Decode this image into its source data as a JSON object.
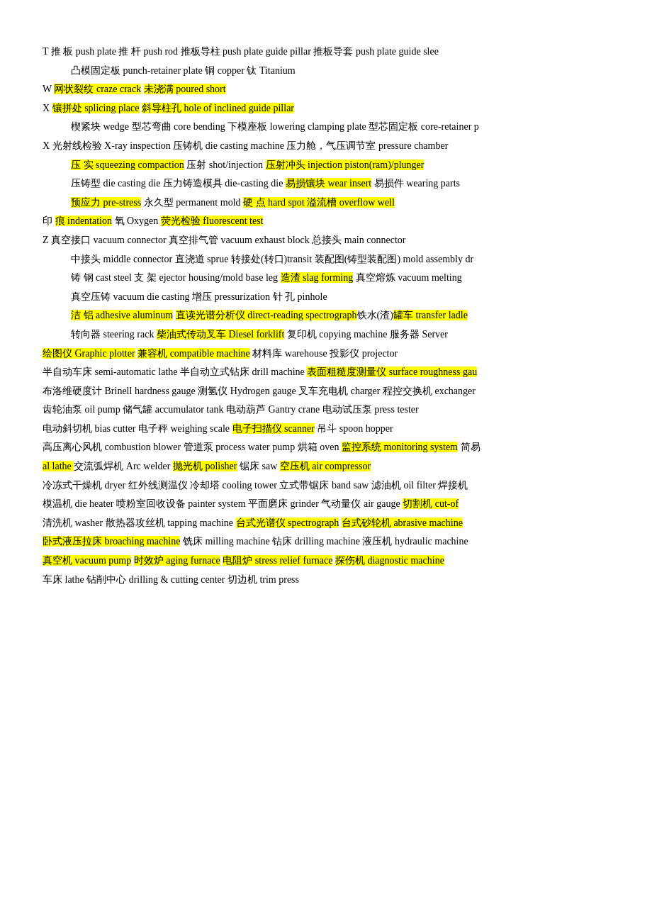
{
  "lines": [
    {
      "id": "line-T",
      "indent": false,
      "prefix": "T",
      "segments": [
        {
          "text": " 推 板 push plate 推 杆 push rod 推板导柱 push plate guide pillar 推板导套 push plate guide slee",
          "highlight": false
        }
      ]
    },
    {
      "id": "line-indent1",
      "indent": true,
      "prefix": "",
      "segments": [
        {
          "text": "凸模固定板 punch-retainer plate 铜 copper   钛 Titanium",
          "highlight": false
        }
      ]
    },
    {
      "id": "line-W",
      "indent": false,
      "prefix": "W",
      "segments": [
        {
          "text": " ",
          "highlight": false
        },
        {
          "text": "网状裂纹 craze crack",
          "highlight": true
        },
        {
          "text": " ",
          "highlight": false
        },
        {
          "text": "未浇满 poured short",
          "highlight": true
        }
      ]
    },
    {
      "id": "line-X1",
      "indent": false,
      "prefix": "X",
      "segments": [
        {
          "text": " ",
          "highlight": false
        },
        {
          "text": "镶拼处 splicing place",
          "highlight": true
        },
        {
          "text": "   ",
          "highlight": false
        },
        {
          "text": "斜导柱孔 hole of inclined guide pillar",
          "highlight": true
        }
      ]
    },
    {
      "id": "line-indent2",
      "indent": true,
      "prefix": "",
      "segments": [
        {
          "text": "楔紧块 wedge 型芯弯曲 core bending 下模座板  lowering clamping plate 型芯固定板 core-retainer p",
          "highlight": false
        }
      ]
    },
    {
      "id": "line-X2",
      "indent": false,
      "prefix": "",
      "segments": [
        {
          "text": "X 光射线检验 X-ray inspection 压铸机 die casting machine 压力舱，气压调节室 pressure chamber",
          "highlight": false
        }
      ]
    },
    {
      "id": "line-indent3",
      "indent": true,
      "prefix": "",
      "segments": [
        {
          "text": "压 实 ",
          "highlight": true
        },
        {
          "text": "squeezing compaction",
          "highlight": true
        },
        {
          "text": " 压射 shot/injection ",
          "highlight": false
        },
        {
          "text": "压射冲头 injection piston(ram)/plunger",
          "highlight": true
        }
      ]
    },
    {
      "id": "line-indent4",
      "indent": true,
      "prefix": "",
      "segments": [
        {
          "text": "压铸型 die casting die 压力铸造模具 die-casting die ",
          "highlight": false
        },
        {
          "text": "易损镶块 wear insert",
          "highlight": true
        },
        {
          "text": " 易损件 wearing parts",
          "highlight": false
        }
      ]
    },
    {
      "id": "line-indent5",
      "indent": true,
      "prefix": "",
      "segments": [
        {
          "text": "预应力 ",
          "highlight": true
        },
        {
          "text": "pre-stress",
          "highlight": true
        },
        {
          "text": " 永久型 permanent mold ",
          "highlight": false
        },
        {
          "text": "硬 点 hard spot 溢流槽 overflow well",
          "highlight": true
        }
      ]
    },
    {
      "id": "line-yin",
      "indent": false,
      "prefix": "印",
      "segments": [
        {
          "text": " ",
          "highlight": false
        },
        {
          "text": "痕 indentation",
          "highlight": true
        },
        {
          "text": " 氧 Oxygen ",
          "highlight": false
        },
        {
          "text": "荧光检验 fluorescent test",
          "highlight": true
        }
      ]
    },
    {
      "id": "line-Z",
      "indent": false,
      "prefix": "Z",
      "segments": [
        {
          "text": " 真空接口 vacuum connector 真空排气管 vacuum exhaust block 总接头 main connector",
          "highlight": false
        }
      ]
    },
    {
      "id": "line-indent6",
      "indent": true,
      "prefix": "",
      "segments": [
        {
          "text": "中接头 middle connector 直浇道 sprue  转接处(转口)transit 装配图(铸型装配图) mold assembly dr",
          "highlight": false
        }
      ]
    },
    {
      "id": "line-indent7",
      "indent": true,
      "prefix": "",
      "segments": [
        {
          "text": "铸 钢 cast steel 支 架 ejector housing/mold base leg ",
          "highlight": false
        },
        {
          "text": "造渣 slag forming",
          "highlight": true
        },
        {
          "text": " 真空熔炼 vacuum melting",
          "highlight": false
        }
      ]
    },
    {
      "id": "line-indent8",
      "indent": true,
      "prefix": "",
      "segments": [
        {
          "text": "真空压铸 vacuum die casting 增压 pressurization 针 孔 pinhole",
          "highlight": false
        }
      ]
    },
    {
      "id": "line-indent9",
      "indent": true,
      "prefix": "",
      "segments": [
        {
          "text": "洁 铝 ",
          "highlight": true
        },
        {
          "text": "adhesive aluminum",
          "highlight": true
        },
        {
          "text": " ",
          "highlight": false
        },
        {
          "text": "直读光谱分析仪 direct-reading spectrograph",
          "highlight": true
        },
        {
          "text": "铁水(渣)",
          "highlight": false
        },
        {
          "text": "罐车 transfer ladle",
          "highlight": true
        }
      ]
    },
    {
      "id": "line-indent10",
      "indent": true,
      "prefix": "",
      "segments": [
        {
          "text": "转向器 steering rack ",
          "highlight": false
        },
        {
          "text": "柴油式传动叉车 Diesel forklift",
          "highlight": true
        },
        {
          "text": " 复印机 copying machine ",
          "highlight": false
        },
        {
          "text": "服务器 Server",
          "highlight": false
        }
      ]
    },
    {
      "id": "line-hui",
      "indent": false,
      "prefix": "",
      "segments": [
        {
          "text": "绘图仪 ",
          "highlight": true
        },
        {
          "text": "Graphic plotter",
          "highlight": true
        },
        {
          "text": " ",
          "highlight": false
        },
        {
          "text": "兼容机 compatible machine",
          "highlight": true
        },
        {
          "text": " 材料库 warehouse 投影仪 projector",
          "highlight": false
        }
      ]
    },
    {
      "id": "line-ban",
      "indent": false,
      "prefix": "",
      "segments": [
        {
          "text": "半自动车床 semi-automatic lathe 半自动立式钻床 drill machine ",
          "highlight": false
        },
        {
          "text": "表面粗糙度测量仪 surface roughness gau",
          "highlight": true
        }
      ]
    },
    {
      "id": "line-bu",
      "indent": false,
      "prefix": "",
      "segments": [
        {
          "text": "布洛维硬度计 Brinell hardness gauge 测氢仪 Hydrogen gauge 叉车充电机 charger 程控交换机 exchanger",
          "highlight": false
        }
      ]
    },
    {
      "id": "line-chi",
      "indent": false,
      "prefix": "",
      "segments": [
        {
          "text": "齿轮油泵 oil pump 储气罐 accumulator tank 电动葫芦 Gantry crane 电动试压泵 press tester",
          "highlight": false
        }
      ]
    },
    {
      "id": "line-dian",
      "indent": false,
      "prefix": "",
      "segments": [
        {
          "text": "电动斜切机 bias cutter 电子秤 weighing scale ",
          "highlight": false
        },
        {
          "text": "电子扫描仪 scanner",
          "highlight": true
        },
        {
          "text": " 吊斗 spoon hopper",
          "highlight": false
        }
      ]
    },
    {
      "id": "line-gao",
      "indent": false,
      "prefix": "",
      "segments": [
        {
          "text": "高压离心风机 combustion blower 管道泵 process water pump 烘箱 oven ",
          "highlight": false
        },
        {
          "text": "监控系统 monitoring system",
          "highlight": true
        },
        {
          "text": " 简易",
          "highlight": false
        }
      ]
    },
    {
      "id": "line-al",
      "indent": false,
      "prefix": "",
      "segments": [
        {
          "text": "al lathe ",
          "highlight": true
        },
        {
          "text": "交流弧焊机 Arc welder ",
          "highlight": false
        },
        {
          "text": "抛光机 polisher",
          "highlight": true
        },
        {
          "text": " 锯床 saw ",
          "highlight": false
        },
        {
          "text": "空压机 air compressor",
          "highlight": true
        }
      ]
    },
    {
      "id": "line-leng",
      "indent": false,
      "prefix": "",
      "segments": [
        {
          "text": "冷冻式干燥机 dryer 红外线测温仪 冷却塔 cooling tower 立式带锯床 band saw 滤油机 oil filter 焊接机",
          "highlight": false
        }
      ]
    },
    {
      "id": "line-mo",
      "indent": false,
      "prefix": "",
      "segments": [
        {
          "text": "模温机 die heater 喷粉室回收设备 painter system 平面磨床 grinder 气动量仪 air gauge ",
          "highlight": false
        },
        {
          "text": "切割机 cut-of",
          "highlight": true
        }
      ]
    },
    {
      "id": "line-qing",
      "indent": false,
      "prefix": "",
      "segments": [
        {
          "text": "清洗机 washer 散热器攻丝机 tapping machine ",
          "highlight": false
        },
        {
          "text": "台式光谱仪 spectrograph",
          "highlight": true
        },
        {
          "text": " ",
          "highlight": false
        },
        {
          "text": "台式砂轮机 abrasive machine",
          "highlight": true
        }
      ]
    },
    {
      "id": "line-wo",
      "indent": false,
      "prefix": "",
      "segments": [
        {
          "text": "卧式液压拉床 ",
          "highlight": true
        },
        {
          "text": "broaching machine",
          "highlight": true
        },
        {
          "text": " 铣床 milling machine 钻床 drilling machine 液压机 hydraulic machine",
          "highlight": false
        }
      ]
    },
    {
      "id": "line-zhen",
      "indent": false,
      "prefix": "",
      "segments": [
        {
          "text": "真空机 ",
          "highlight": true
        },
        {
          "text": "vacuum pump",
          "highlight": true
        },
        {
          "text": " ",
          "highlight": false
        },
        {
          "text": "时效炉 aging furnace",
          "highlight": true
        },
        {
          "text": " ",
          "highlight": false
        },
        {
          "text": "电阻炉 stress relief furnace",
          "highlight": true
        },
        {
          "text": " ",
          "highlight": false
        },
        {
          "text": "探伤机 diagnostic machine",
          "highlight": true
        }
      ]
    },
    {
      "id": "line-che",
      "indent": false,
      "prefix": "",
      "segments": [
        {
          "text": "车床 lathe   钻削中心 drilling & cutting center 切边机 trim press",
          "highlight": false
        }
      ]
    }
  ]
}
